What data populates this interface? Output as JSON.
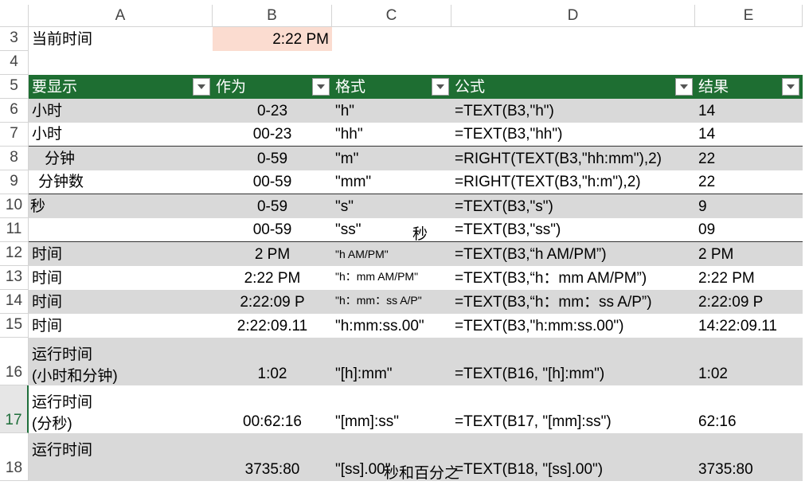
{
  "columns": [
    "A",
    "B",
    "C",
    "D",
    "E"
  ],
  "row3": {
    "num": "3",
    "label": "当前时间",
    "value": "2:22 PM"
  },
  "row4": {
    "num": "4"
  },
  "header": {
    "num": "5",
    "a": "要显示",
    "b": "作为",
    "c": "格式",
    "d": "公式",
    "e": "结果"
  },
  "rows": [
    {
      "num": "6",
      "a": "小时",
      "b": "0-23",
      "c": "\"h\"",
      "d": "=TEXT(B3,\"h\")",
      "e": "14"
    },
    {
      "num": "7",
      "a": "小时",
      "b": "00-23",
      "c": "\"hh\"",
      "d": "=TEXT(B3,\"hh\")",
      "e": "14"
    },
    {
      "num": "8",
      "a": "分钟",
      "b": "0-59",
      "c": "\"m\"",
      "d": "=RIGHT(TEXT(B3,\"hh:mm\"),2)",
      "e": "22"
    },
    {
      "num": "9",
      "a": "分钟数",
      "b": "00-59",
      "c": "\"mm\"",
      "d": "=RIGHT(TEXT(B3,\"h:m\"),2)",
      "e": "22"
    },
    {
      "num": "10",
      "a": "秒",
      "b": "0-59",
      "c": "\"s\"",
      "d": "=TEXT(B3,\"s\")",
      "e": "9"
    },
    {
      "num": "11",
      "a": "",
      "b": "00-59",
      "c": "\"ss\"",
      "c2": "秒",
      "d": "=TEXT(B3,\"ss\")",
      "e": "09"
    },
    {
      "num": "12",
      "a": "时间",
      "b": "2 PM",
      "c": "\"h AM/PM\"",
      "d": "=TEXT(B3,“h AM/PM”)",
      "e": "2 PM"
    },
    {
      "num": "13",
      "a": "时间",
      "b": "2:22 PM",
      "c": "\"h：mm AM/PM\"",
      "d": "=TEXT(B3,“h：mm AM/PM”)",
      "e": "2:22 PM"
    },
    {
      "num": "14",
      "a": "时间",
      "b": "2:22:09 P",
      "c": "\"h：mm：ss A/P\"",
      "d": "=TEXT(B3,“h：mm：ss A/P”)",
      "e": "2:22:09 P"
    },
    {
      "num": "15",
      "a": "时间",
      "b": "2:22:09.11",
      "c": "\"h:mm:ss.00\"",
      "d": "=TEXT(B3,\"h:mm:ss.00\")",
      "e": "14:22:09.11"
    },
    {
      "num": "16",
      "a1": "运行时间",
      "a2": "(小时和分钟)",
      "b": "1:02",
      "c": "\"[h]:mm\"",
      "d": "=TEXT(B16, \"[h]:mm\")",
      "e": "1:02"
    },
    {
      "num": "17",
      "a1": "运行时间",
      "a2": "(分秒)",
      "b": "00:62:16",
      "c": "\"[mm]:ss\"",
      "d": "=TEXT(B17, \"[mm]:ss\")",
      "e": "62:16"
    },
    {
      "num": "18",
      "a1": "运行时间",
      "b": "3735:80",
      "c": "\"[ss].00\"",
      "c2": "秒和百分之",
      "d": "=TEXT(B18, \"[ss].00\")",
      "e": "3735:80"
    }
  ],
  "colors": {
    "header_bg": "#1e6e32",
    "band": "#d9d9d9",
    "highlight": "#fbdcd0"
  }
}
